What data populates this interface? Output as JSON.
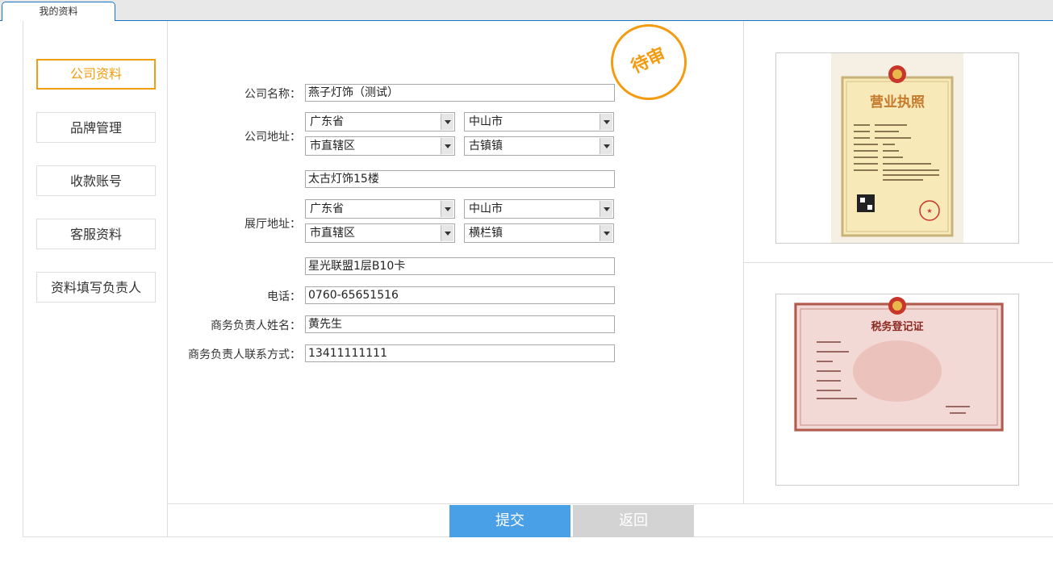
{
  "tab": {
    "label": "我的资料"
  },
  "sidebar": {
    "items": [
      {
        "label": "公司资料",
        "active": true
      },
      {
        "label": "品牌管理",
        "active": false
      },
      {
        "label": "收款账号",
        "active": false
      },
      {
        "label": "客服资料",
        "active": false
      },
      {
        "label": "资料填写负责人",
        "active": false
      }
    ]
  },
  "status_stamp": "待审",
  "form": {
    "company_name": {
      "label": "公司名称：",
      "value": "燕子灯饰（测试）"
    },
    "company_address": {
      "label": "公司地址：",
      "province": "广东省",
      "city": "中山市",
      "district": "市直辖区",
      "town": "古镇镇",
      "detail": "太古灯饰15楼"
    },
    "showroom_address": {
      "label": "展厅地址：",
      "province": "广东省",
      "city": "中山市",
      "district": "市直辖区",
      "town": "横栏镇",
      "detail": "星光联盟1层B10卡"
    },
    "phone": {
      "label": "电话：",
      "value": "0760-65651516"
    },
    "contact_name": {
      "label": "商务负责人姓名：",
      "value": "黄先生"
    },
    "contact_phone": {
      "label": "商务负责人联系方式：",
      "value": "13411111111"
    }
  },
  "documents": {
    "license_title": "营业执照",
    "tax_title": "税务登记证"
  },
  "buttons": {
    "submit": "提交",
    "back": "返回"
  },
  "colors": {
    "accent": "#f39c12",
    "primary": "#4aa0e6",
    "disabled": "#d3d3d3",
    "tab_border": "#1a76c2"
  }
}
